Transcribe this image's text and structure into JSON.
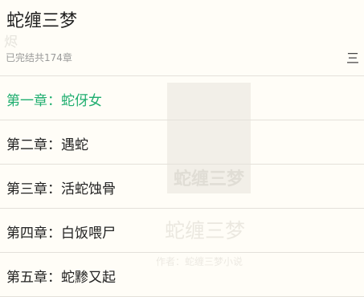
{
  "book": {
    "title": "蛇缠三梦",
    "faint_glyph": "烬",
    "status": "已完结共174章",
    "sort_toggle": "三"
  },
  "cover": {
    "title": "蛇缠三梦",
    "big_title": "蛇缠三梦",
    "subtitle": "作者：蛇缠三梦小说"
  },
  "chapters": [
    {
      "label": "第一章：蛇伢女",
      "active": true
    },
    {
      "label": "第二章：遇蛇",
      "active": false
    },
    {
      "label": "第三章：活蛇蚀骨",
      "active": false
    },
    {
      "label": "第四章：白饭喂尸",
      "active": false
    },
    {
      "label": "第五章：蛇黪又起",
      "active": false
    }
  ],
  "colors": {
    "accent": "#1fae6f",
    "background": "#fffdf7",
    "divider": "#e4e1da"
  }
}
